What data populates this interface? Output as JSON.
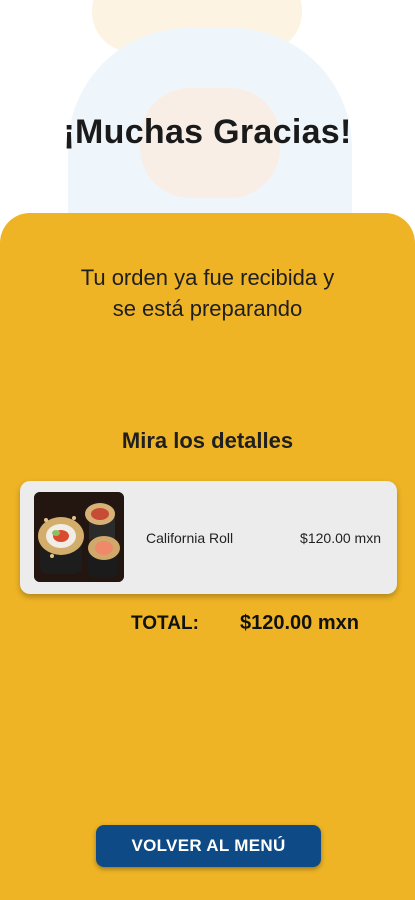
{
  "header": {
    "title": "¡Muchas Gracias!"
  },
  "confirmation": {
    "line1": "Tu orden ya fue recibida y",
    "line2": "se está preparando"
  },
  "details": {
    "heading": "Mira los detalles",
    "items": [
      {
        "name": "California Roll",
        "price": "$120.00 mxn",
        "image": "sushi-roll-photo"
      }
    ]
  },
  "summary": {
    "total_label": "TOTAL:",
    "total_value": "$120.00 mxn"
  },
  "actions": {
    "back_label": "VOLVER AL MENÚ"
  },
  "colors": {
    "panel": "#eeb425",
    "button": "#0e4b86",
    "card": "#ececec"
  }
}
